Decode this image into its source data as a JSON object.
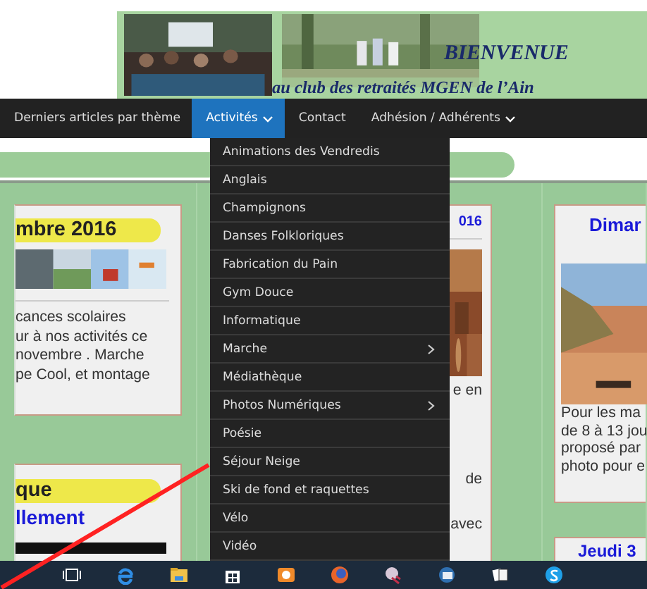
{
  "banner": {
    "title": "BIENVENUE",
    "subtitle": "au club des retraités MGEN de l’Ain"
  },
  "nav": [
    {
      "label": "Derniers articles par thème",
      "selected": false,
      "has_submenu": false
    },
    {
      "label": "Activités",
      "selected": true,
      "has_submenu": true
    },
    {
      "label": "Contact",
      "selected": false,
      "has_submenu": false
    },
    {
      "label": "Adhésion / Adhérents",
      "selected": false,
      "has_submenu": true
    }
  ],
  "dropdown": [
    {
      "label": "Animations des Vendredis",
      "has_submenu": false
    },
    {
      "label": "Anglais",
      "has_submenu": false
    },
    {
      "label": "Champignons",
      "has_submenu": false
    },
    {
      "label": "Danses Folkloriques",
      "has_submenu": false
    },
    {
      "label": "Fabrication du Pain",
      "has_submenu": false
    },
    {
      "label": "Gym Douce",
      "has_submenu": false
    },
    {
      "label": "Informatique",
      "has_submenu": false
    },
    {
      "label": "Marche",
      "has_submenu": true
    },
    {
      "label": "Médiathèque",
      "has_submenu": false
    },
    {
      "label": "Photos Numériques",
      "has_submenu": true
    },
    {
      "label": "Poésie",
      "has_submenu": false
    },
    {
      "label": "Séjour Neige",
      "has_submenu": false
    },
    {
      "label": "Ski de fond et raquettes",
      "has_submenu": false
    },
    {
      "label": "Vélo",
      "has_submenu": false
    },
    {
      "label": "Vidéo",
      "has_submenu": false
    }
  ],
  "left_cards": [
    {
      "heading": "mbre 2016",
      "lines": [
        "cances scolaires",
        "ur à nos activités ce",
        "novembre . Marche",
        "pe Cool, et montage"
      ]
    },
    {
      "heading": "que",
      "title": "llement"
    }
  ],
  "middle_card": {
    "heading": "016",
    "lines": [
      "e en",
      "de",
      "avec"
    ]
  },
  "right_cards": [
    {
      "heading": "Dimar",
      "lines": [
        "Pour les ma",
        "de 8 à 13 jou",
        "proposé par",
        "photo pour e"
      ]
    },
    {
      "heading": "Jeudi 3"
    }
  ]
}
